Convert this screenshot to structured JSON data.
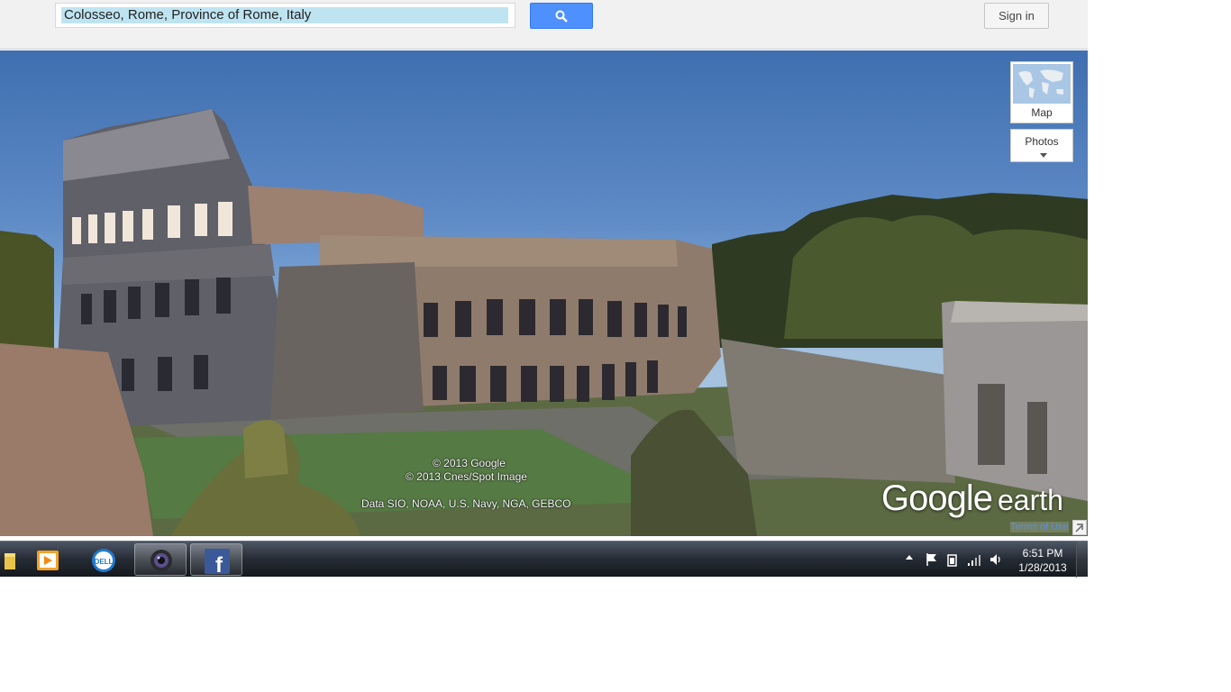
{
  "search": {
    "query": "Colosseo, Rome, Province of Rome, Italy",
    "button_icon": "search-icon"
  },
  "header": {
    "signin_label": "Sign in"
  },
  "layers": {
    "map_label": "Map",
    "photos_label": "Photos"
  },
  "attribution": {
    "copyright_google": "© 2013 Google",
    "copyright_cnes": "© 2013 Cnes/Spot Image",
    "data_sources": "Data SIO, NOAA, U.S. Navy, NGA, GEBCO",
    "logo_google": "Google",
    "logo_earth": "earth",
    "terms_label": "Terms of Use"
  },
  "taskbar": {
    "items": [
      {
        "icon": "folder-icon"
      },
      {
        "icon": "media-player-icon"
      },
      {
        "icon": "dell-icon"
      },
      {
        "icon": "webcam-icon"
      },
      {
        "icon": "facebook-icon"
      }
    ],
    "clock_time": "6:51 PM",
    "clock_date": "1/28/2013"
  },
  "colors": {
    "search_button": "#4d90fe",
    "search_highlight": "#bfe4f1",
    "sky_top": "#3f6fb0",
    "taskbar": "#262c35"
  }
}
